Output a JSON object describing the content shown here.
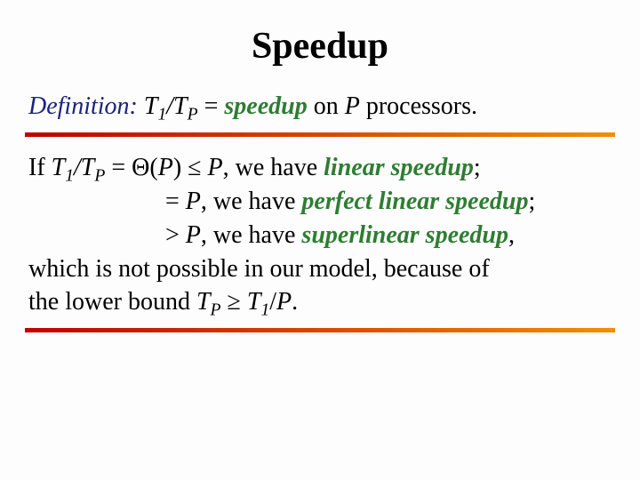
{
  "title": "Speedup",
  "definition": {
    "label": "Definition:",
    "t": "T",
    "sub1": "1",
    "slashT": "/T",
    "subP": "P",
    "equals": " = ",
    "speedup": "speedup",
    "on": " on ",
    "Pvar": "P",
    "tail": " processors."
  },
  "body": {
    "line1": {
      "if": "If ",
      "t": "T",
      "sub1": "1",
      "slashT": "/T",
      "subP": "P",
      "eqTheta": " = Θ(",
      "Pvar": "P",
      "close": ")",
      "le": " ≤ ",
      "Pvar2": "P",
      "comma": ", we have ",
      "linear": "linear speedup",
      "semi": ";"
    },
    "line2": {
      "eq": "= ",
      "Pvar": "P",
      "comma": ", we have ",
      "perfect": "perfect linear speedup",
      "semi": ";"
    },
    "line3": {
      "gt": "> ",
      "Pvar": "P",
      "comma": ", we have ",
      "super": "superlinear speedup",
      "commaEnd": ","
    },
    "line4": "which is not possible in our model, because of",
    "line5": {
      "pre": "the lower bound ",
      "t": "T",
      "subP": "P",
      "ge": " ≥ ",
      "t2": "T",
      "sub1": "1",
      "slash": "/",
      "Pvar": "P",
      "dot": "."
    }
  }
}
